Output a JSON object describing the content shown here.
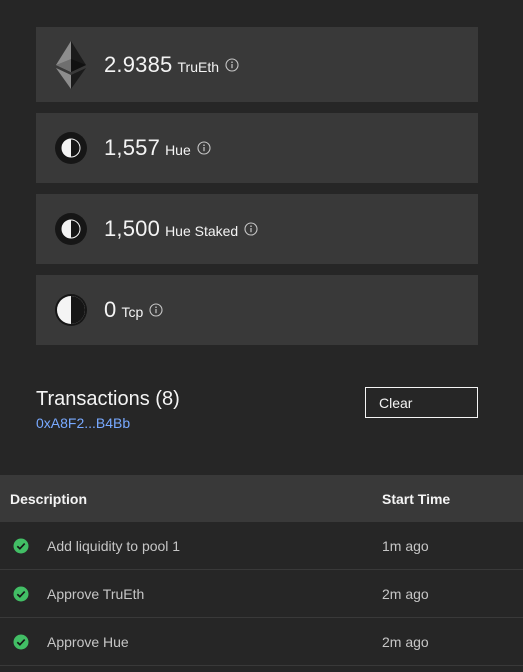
{
  "balances": [
    {
      "icon": "eth-diamond-icon",
      "amount": "2.9385",
      "unit": "TruEth"
    },
    {
      "icon": "hue-token-icon",
      "amount": "1,557",
      "unit": "Hue"
    },
    {
      "icon": "hue-token-icon",
      "amount": "1,500",
      "unit": "Hue Staked"
    },
    {
      "icon": "tcp-token-icon",
      "amount": "0",
      "unit": "Tcp"
    }
  ],
  "transactions": {
    "title": "Transactions (8)",
    "address": "0xA8F2...B4Bb",
    "clear_label": "Clear",
    "columns": {
      "description": "Description",
      "start_time": "Start Time"
    },
    "rows": [
      {
        "status": "success",
        "description": "Add liquidity to pool 1",
        "time": "1m ago"
      },
      {
        "status": "success",
        "description": "Approve TruEth",
        "time": "2m ago"
      },
      {
        "status": "success",
        "description": "Approve Hue",
        "time": "2m ago"
      }
    ]
  },
  "colors": {
    "background": "#262626",
    "card": "#393939",
    "link": "#78a9ff",
    "success": "#42be65"
  }
}
